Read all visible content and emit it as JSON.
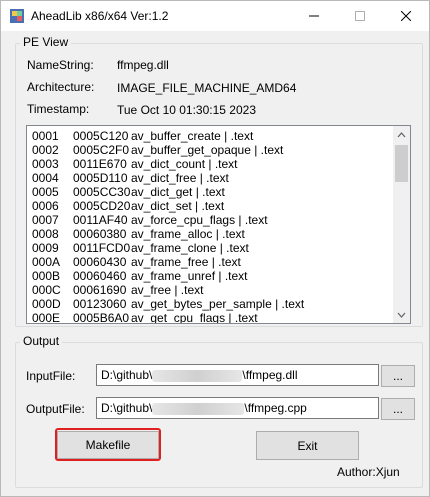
{
  "window": {
    "title": "AheadLib x86/x64   Ver:1.2"
  },
  "pe_view": {
    "group_label": "PE View",
    "namestring_label": "NameString:",
    "namestring_value": "ffmpeg.dll",
    "architecture_label": "Architecture:",
    "architecture_value": "IMAGE_FILE_MACHINE_AMD64",
    "timestamp_label": "Timestamp:",
    "timestamp_value": "Tue Oct 10 01:30:15 2023",
    "exports": [
      {
        "ordinal": "0001",
        "rva": "0005C120",
        "entry": "av_buffer_create | .text"
      },
      {
        "ordinal": "0002",
        "rva": "0005C2F0",
        "entry": "av_buffer_get_opaque | .text"
      },
      {
        "ordinal": "0003",
        "rva": "0011E670",
        "entry": "av_dict_count | .text"
      },
      {
        "ordinal": "0004",
        "rva": "0005D110",
        "entry": "av_dict_free | .text"
      },
      {
        "ordinal": "0005",
        "rva": "0005CC30",
        "entry": "av_dict_get | .text"
      },
      {
        "ordinal": "0006",
        "rva": "0005CD20",
        "entry": "av_dict_set | .text"
      },
      {
        "ordinal": "0007",
        "rva": "0011AF40",
        "entry": "av_force_cpu_flags | .text"
      },
      {
        "ordinal": "0008",
        "rva": "00060380",
        "entry": "av_frame_alloc | .text"
      },
      {
        "ordinal": "0009",
        "rva": "0011FCD0",
        "entry": "av_frame_clone | .text"
      },
      {
        "ordinal": "000A",
        "rva": "00060430",
        "entry": "av_frame_free | .text"
      },
      {
        "ordinal": "000B",
        "rva": "00060460",
        "entry": "av_frame_unref | .text"
      },
      {
        "ordinal": "000C",
        "rva": "00061690",
        "entry": "av_free | .text"
      },
      {
        "ordinal": "000D",
        "rva": "00123060",
        "entry": "av_get_bytes_per_sample | .text"
      },
      {
        "ordinal": "000E",
        "rva": "0005B6A0",
        "entry": "av_get_cpu_flags | .text"
      }
    ]
  },
  "output": {
    "group_label": "Output",
    "input_file_label": "InputFile:",
    "input_file_prefix": "D:\\github\\",
    "input_file_suffix": "\\ffmpeg.dll",
    "output_file_label": "OutputFile:",
    "output_file_prefix": "D:\\github\\",
    "output_file_suffix": "\\ffmpeg.cpp",
    "browse_label": "...",
    "makefile_label": "Makefile",
    "exit_label": "Exit",
    "author": "Author:Xjun"
  },
  "colors": {
    "highlight": "#e02020",
    "window_bg": "#f0f0f0"
  }
}
